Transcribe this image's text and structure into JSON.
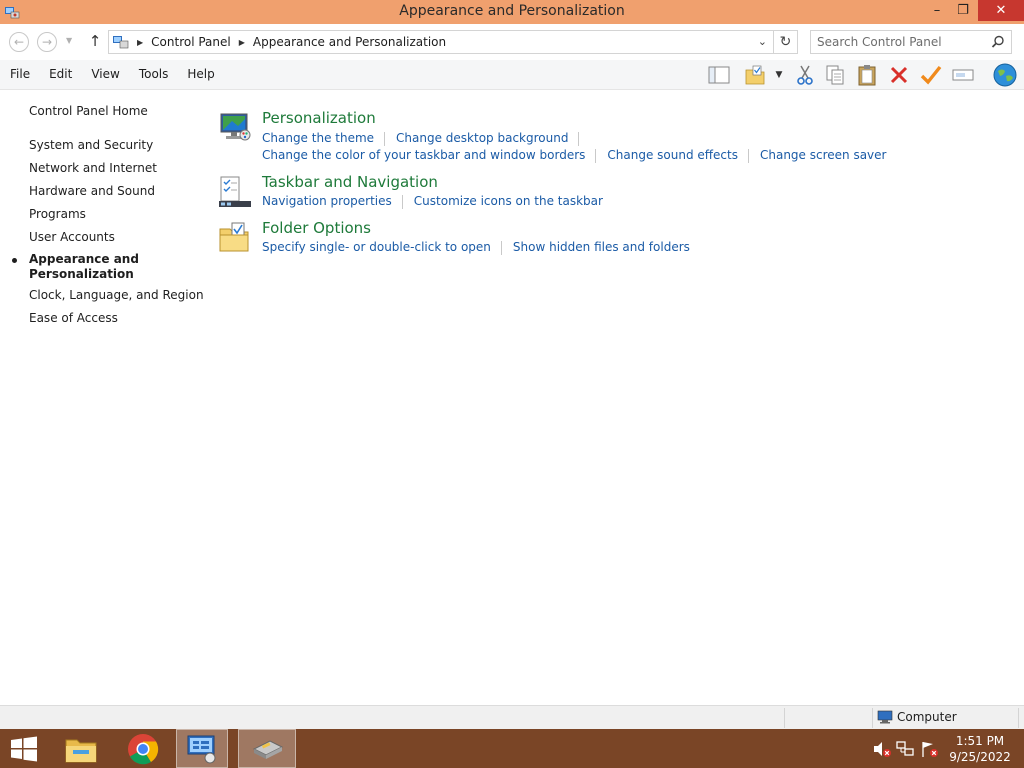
{
  "window": {
    "title": "Appearance and Personalization",
    "controls": {
      "minimize": "–",
      "maximize": "❐",
      "close": "✕"
    }
  },
  "address_bar": {
    "breadcrumbs": [
      "Control Panel",
      "Appearance and Personalization"
    ],
    "search_placeholder": "Search Control Panel"
  },
  "menu": [
    "File",
    "Edit",
    "View",
    "Tools",
    "Help"
  ],
  "toolbar_icons": [
    "layout-pane-icon",
    "folder-options-icon",
    "dropdown-arrow-icon",
    "cut-icon",
    "copy-icon",
    "paste-icon",
    "delete-icon",
    "properties-checkmark-icon",
    "rename-icon",
    "globe-icon"
  ],
  "sidebar": {
    "home": "Control Panel Home",
    "items": [
      "System and Security",
      "Network and Internet",
      "Hardware and Sound",
      "Programs",
      "User Accounts"
    ],
    "current": "Appearance and Personalization",
    "items_after": [
      "Clock, Language, and Region",
      "Ease of Access"
    ]
  },
  "categories": [
    {
      "title": "Personalization",
      "links_row1": [
        "Change the theme",
        "Change desktop background"
      ],
      "links_row2": [
        "Change the color of your taskbar and window borders",
        "Change sound effects",
        "Change screen saver"
      ]
    },
    {
      "title": "Taskbar and Navigation",
      "links_row1": [
        "Navigation properties",
        "Customize icons on the taskbar"
      ]
    },
    {
      "title": "Folder Options",
      "links_row1": [
        "Specify single- or double-click to open",
        "Show hidden files and folders"
      ]
    }
  ],
  "status_bar": {
    "zone": "Computer"
  },
  "taskbar": {
    "time": "1:51 PM",
    "date": "9/25/2022"
  },
  "colors": {
    "titlebar": "#f0a06e",
    "taskbar": "#7a4526",
    "link": "#1b5ba6",
    "category_title": "#1e7a3a"
  }
}
